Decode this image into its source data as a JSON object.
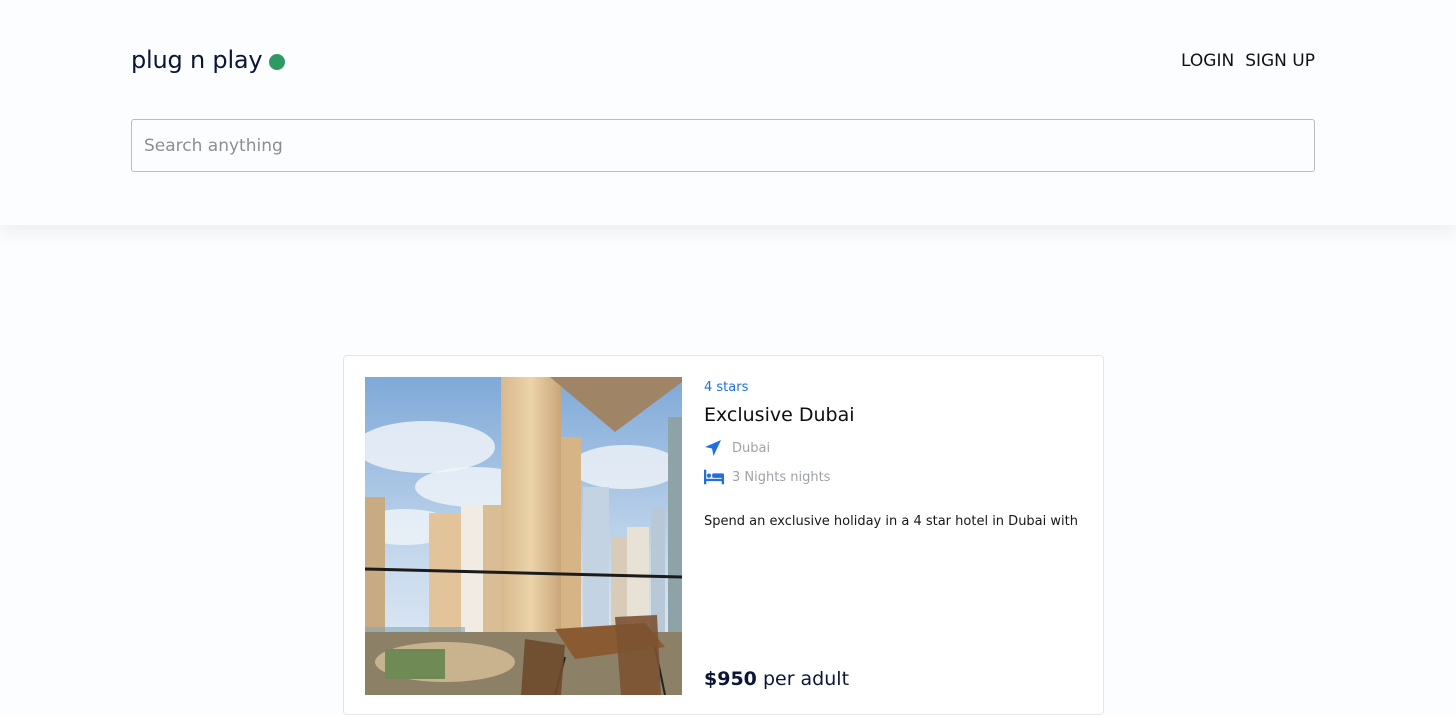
{
  "header": {
    "logo_text": "plug n play",
    "logo_dot_color": "#2e9a63",
    "nav": {
      "login": "LOGIN",
      "signup": "SIGN UP"
    },
    "search": {
      "placeholder": "Search anything",
      "value": ""
    }
  },
  "listing": {
    "rating": "4 stars",
    "title": "Exclusive Dubai",
    "location": "Dubai",
    "duration": "3 Nights nights",
    "description": "Spend an exclusive holiday in a 4 star hotel in Dubai with",
    "price_amount": "$950",
    "price_unit": "per adult",
    "location_icon": "location-arrow-icon",
    "duration_icon": "bed-icon",
    "accent_color": "#1e6fe0"
  }
}
